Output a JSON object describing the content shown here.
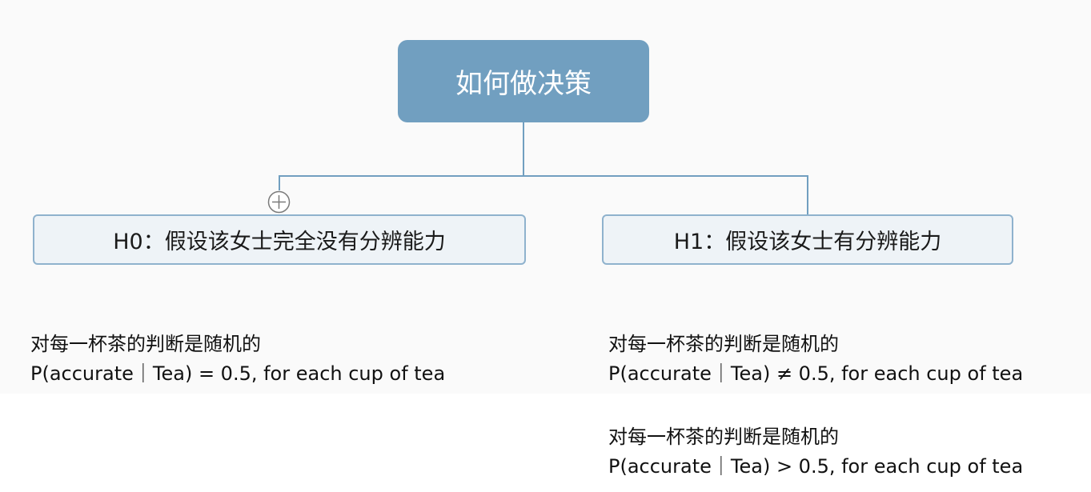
{
  "mindmap": {
    "root": {
      "label": "如何做决策"
    },
    "nodes": [
      {
        "label": "H0：假设该女士完全没有分辨能力"
      },
      {
        "label": "H1：假设该女士有分辨能力"
      }
    ],
    "expand_icon": "circle-plus-icon"
  },
  "notes": {
    "h0": {
      "line1": "对每一杯茶的判断是随机的",
      "line2": "P(accurate｜Tea) = 0.5, for each cup of tea"
    },
    "h1_a": {
      "line1": "对每一杯茶的判断是随机的",
      "line2": "P(accurate｜Tea) ≠ 0.5, for each cup of tea"
    },
    "h1_b": {
      "line1": "对每一杯茶的判断是随机的",
      "line2": "P(accurate｜Tea) > 0.5, for each cup of tea"
    }
  },
  "colors": {
    "root_fill": "#719fc0",
    "node_fill": "#eef3f7",
    "node_border": "#8fb2cd",
    "connector": "#719fc0"
  }
}
